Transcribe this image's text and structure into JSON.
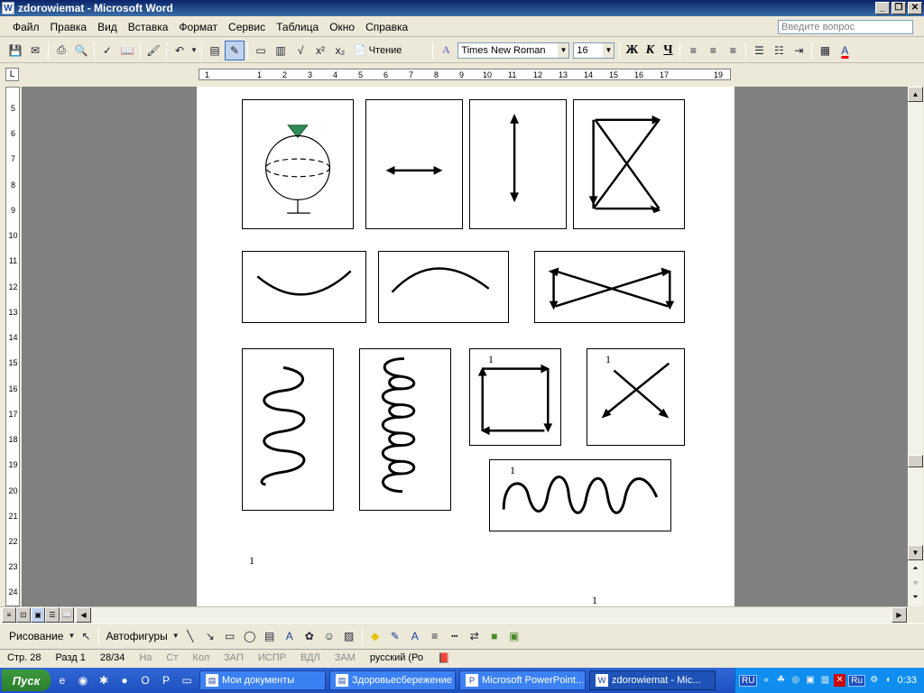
{
  "window": {
    "title": "zdorowiemat - Microsoft Word",
    "icon": "word-doc-icon"
  },
  "menu": {
    "items": [
      "Файл",
      "Правка",
      "Вид",
      "Вставка",
      "Формат",
      "Сервис",
      "Таблица",
      "Окно",
      "Справка"
    ],
    "help_placeholder": "Введите вопрос"
  },
  "toolbar": {
    "read_label": "Чтение",
    "font_name": "Times New Roman",
    "font_size": "16",
    "bold": "Ж",
    "italic": "К",
    "underline": "Ч"
  },
  "ruler": {
    "h_numbers": [
      "1",
      "1",
      "2",
      "3",
      "4",
      "5",
      "6",
      "7",
      "8",
      "9",
      "10",
      "11",
      "12",
      "13",
      "14",
      "15",
      "16",
      "17",
      "19"
    ],
    "v_numbers": [
      "5",
      "6",
      "7",
      "8",
      "9",
      "10",
      "11",
      "12",
      "13",
      "14",
      "15",
      "16",
      "17",
      "18",
      "19",
      "20",
      "21",
      "22",
      "23",
      "24"
    ]
  },
  "document": {
    "labels": {
      "square_label": "1",
      "cross_label": "1",
      "wave_label": "1",
      "bottom_left": "1",
      "page_number": "1"
    }
  },
  "drawing_toolbar": {
    "draw_label": "Рисование",
    "autoshapes_label": "Автофигуры"
  },
  "status": {
    "page": "Стр. 28",
    "section": "Разд 1",
    "pages": "28/34",
    "at": "На",
    "line": "Ст",
    "col": "Кол",
    "rec": "ЗАП",
    "trk": "ИСПР",
    "ext": "ВДЛ",
    "ovr": "ЗАМ",
    "language": "русский (Ро"
  },
  "taskbar": {
    "start_label": "Пуск",
    "tasks": [
      "Мои документы",
      "Здоровьесбережение",
      "Microsoft PowerPoint...",
      "zdorowiemat - Mic..."
    ],
    "tray_lang": "RU",
    "tray_lang2": "Ru",
    "clock": "0:33"
  }
}
